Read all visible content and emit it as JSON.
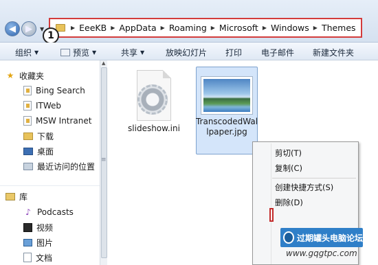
{
  "address": {
    "step_number": "1",
    "crumbs": [
      "EeeKB",
      "AppData",
      "Roaming",
      "Microsoft",
      "Windows",
      "Themes"
    ]
  },
  "toolbar": {
    "organize": "组织",
    "preview": "预览",
    "share": "共享",
    "slideshow": "放映幻灯片",
    "print": "打印",
    "email": "电子邮件",
    "new_folder": "新建文件夹"
  },
  "nav": {
    "favorites": "收藏夹",
    "favorite_items": [
      "Bing Search",
      "ITWeb",
      "MSW Intranet",
      "下载",
      "桌面",
      "最近访问的位置"
    ],
    "libraries": "库",
    "library_items": [
      "Podcasts",
      "视频",
      "图片",
      "文档"
    ]
  },
  "files": {
    "slideshow": "slideshow.ini",
    "wallpaper_line1": "TranscodedWal",
    "wallpaper_line2": "lpaper.jpg"
  },
  "context_menu": {
    "cut": "剪切(T)",
    "copy": "复制(C)",
    "create_shortcut": "创建快捷方式(S)",
    "delete": "删除(D)"
  },
  "watermark": {
    "name": "过期罐头电脑论坛",
    "url": "www.gqgtpc.com"
  }
}
